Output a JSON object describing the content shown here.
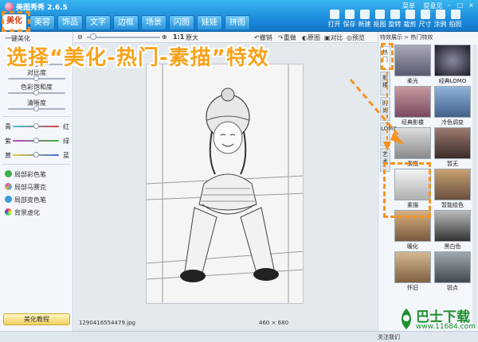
{
  "app": {
    "title": "美图秀秀 2.6.5",
    "links": [
      "菜单",
      "提意见"
    ]
  },
  "tabs": [
    "美化",
    "美容",
    "饰品",
    "文字",
    "边框",
    "场景",
    "闪图",
    "娃娃",
    "拼图"
  ],
  "toolbar": [
    "打开",
    "保存",
    "新建",
    "抠图",
    "旋转",
    "裁剪",
    "尺寸",
    "涂鸦",
    "拍照"
  ],
  "left_panel": {
    "one_click": "一键美化",
    "sliders": [
      "亮度",
      "对比度",
      "色彩饱和度",
      "清晰度"
    ],
    "color_sliders": [
      {
        "left": "青",
        "right": "红"
      },
      {
        "left": "紫",
        "right": "绿"
      },
      {
        "left": "黄",
        "right": "蓝"
      }
    ],
    "tools": [
      "局部彩色笔",
      "局部马赛克",
      "局部变色笔",
      "背景虚化"
    ],
    "tutorial": "美化教程"
  },
  "canvas": {
    "zoom": "1:1",
    "zoom_label": "原大",
    "tools": [
      "撤销",
      "重做",
      "原图",
      "对比",
      "预览"
    ],
    "file_name": "1290416554479.jpg",
    "size": "460 × 680"
  },
  "right_panel": {
    "breadcrumb": "特效展示 > 热门特效",
    "categories": [
      "热门",
      "影楼",
      "时尚",
      "LOMO",
      "艺术"
    ],
    "effects": [
      "柔光",
      "经典LOMO",
      "经典影楼",
      "冷色调变",
      "素描",
      "暂无",
      "素描",
      "暂能绘色",
      "暖化",
      "黑白色",
      "怀旧",
      "锐点"
    ]
  },
  "overlay": {
    "title": "选择“美化-热门-素描”特效",
    "watermark": "巴士下载",
    "watermark_url": "www.11684.com"
  },
  "footer": {
    "weibo": "关注我们"
  }
}
